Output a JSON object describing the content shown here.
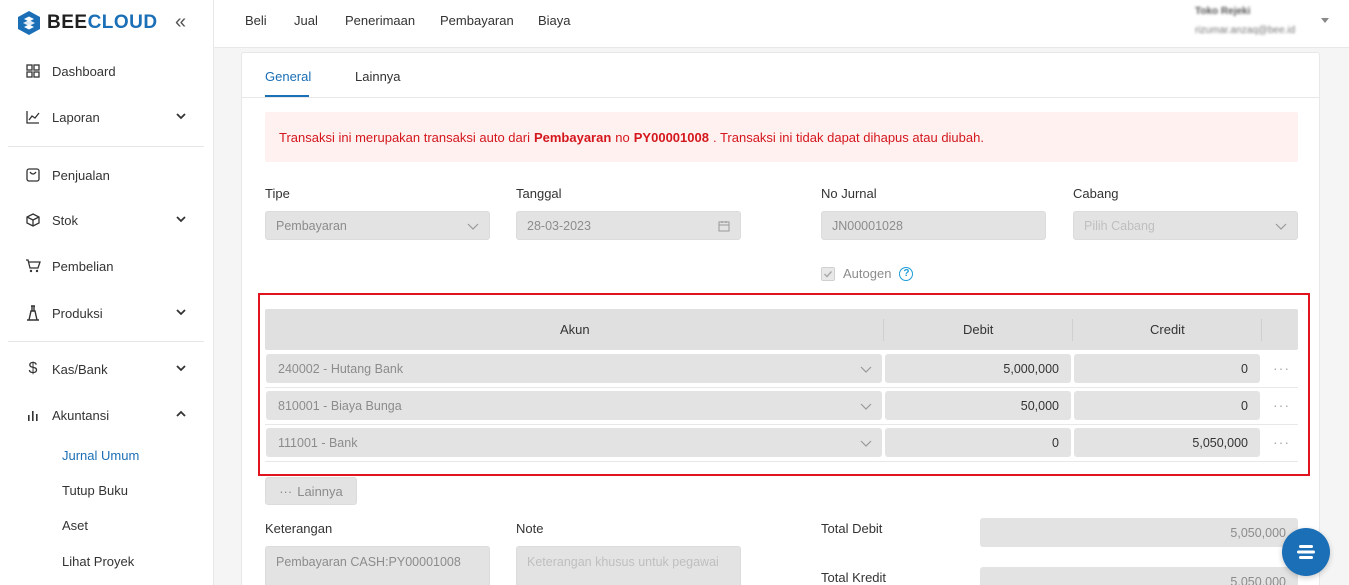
{
  "brand": {
    "name_bee": "BEE",
    "name_cloud": "CLOUD",
    "accent": "#1b6fb6"
  },
  "sidebar": {
    "items": [
      {
        "label": "Dashboard",
        "icon": "dashboard-icon"
      },
      {
        "label": "Laporan",
        "icon": "chart-line-icon"
      },
      {
        "label": "Penjualan",
        "icon": "sales-icon"
      },
      {
        "label": "Stok",
        "icon": "box-icon"
      },
      {
        "label": "Pembelian",
        "icon": "cart-icon"
      },
      {
        "label": "Produksi",
        "icon": "factory-icon"
      },
      {
        "label": "Kas/Bank",
        "icon": "dollar-icon"
      },
      {
        "label": "Akuntansi",
        "icon": "bar-chart-icon"
      }
    ],
    "sub_items": [
      "Jurnal Umum",
      "Tutup Buku",
      "Aset",
      "Lihat Proyek"
    ]
  },
  "topbar": {
    "links": [
      "Beli",
      "Jual",
      "Penerimaan",
      "Pembayaran",
      "Biaya"
    ],
    "user_name": "Toko Rejeki",
    "user_email": "rizumar.anzaq@bee.id"
  },
  "tabs": [
    "General",
    "Lainnya"
  ],
  "alert": {
    "prefix": "Transaksi ini merupakan transaksi auto dari",
    "source": "Pembayaran",
    "mid": "no",
    "ref": "PY00001008",
    "suffix": ". Transaksi ini tidak dapat dihapus atau diubah."
  },
  "form": {
    "tipe_label": "Tipe",
    "tipe_value": "Pembayaran",
    "tanggal_label": "Tanggal",
    "tanggal_value": "28-03-2023",
    "nojurnal_label": "No Jurnal",
    "nojurnal_value": "JN00001028",
    "cabang_label": "Cabang",
    "cabang_placeholder": "Pilih Cabang",
    "autogen_label": "Autogen"
  },
  "journal": {
    "headers": {
      "akun": "Akun",
      "debit": "Debit",
      "credit": "Credit"
    },
    "rows": [
      {
        "akun": "240002 - Hutang Bank",
        "debit": "5,000,000",
        "credit": "0"
      },
      {
        "akun": "810001 - Biaya Bunga",
        "debit": "50,000",
        "credit": "0"
      },
      {
        "akun": "111001 - Bank",
        "debit": "0",
        "credit": "5,050,000"
      }
    ],
    "more_button": "Lainnya"
  },
  "footer": {
    "keterangan_label": "Keterangan",
    "keterangan_value": "Pembayaran CASH:PY00001008",
    "note_label": "Note",
    "note_placeholder": "Keterangan khusus untuk pegawai",
    "total_debit_label": "Total Debit",
    "total_debit_value": "5,050,000",
    "total_kredit_label": "Total Kredit",
    "total_kredit_value": "5,050,000"
  }
}
